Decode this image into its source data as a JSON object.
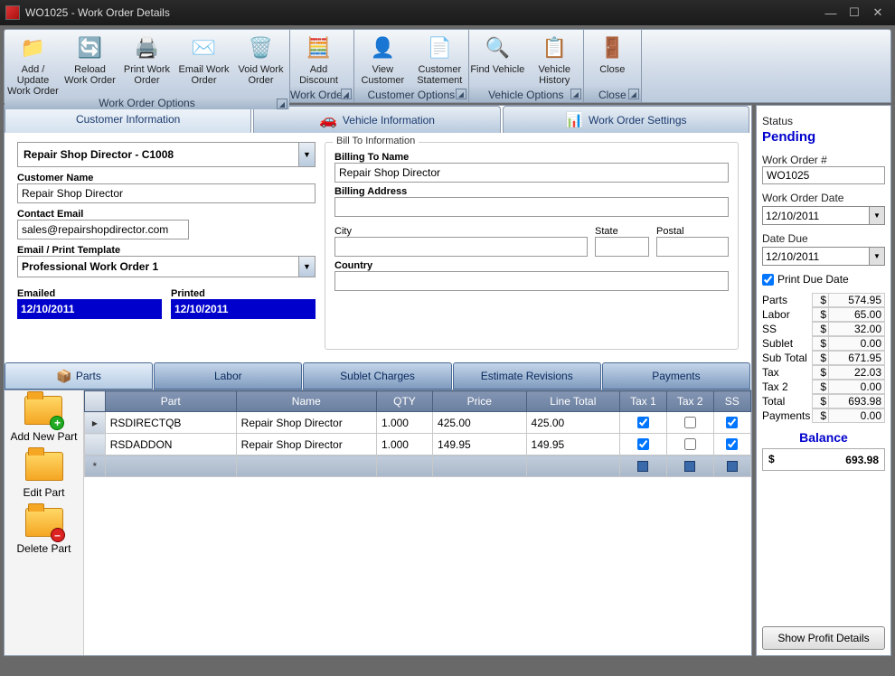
{
  "window": {
    "title": "WO1025 - Work Order Details"
  },
  "ribbon": {
    "groups": [
      {
        "label": "Work Order Options",
        "buttons": [
          {
            "icon": "📁",
            "label": "Add / Update\nWork Order"
          },
          {
            "icon": "🔄",
            "label": "Reload\nWork Order"
          },
          {
            "icon": "🖨️",
            "label": "Print Work\nOrder"
          },
          {
            "icon": "✉️",
            "label": "Email Work\nOrder"
          },
          {
            "icon": "🗑️",
            "label": "Void Work\nOrder"
          }
        ]
      },
      {
        "label": "Work Orde…",
        "buttons": [
          {
            "icon": "🧮",
            "label": "Add Discount"
          }
        ]
      },
      {
        "label": "Customer Options",
        "buttons": [
          {
            "icon": "👤",
            "label": "View Customer"
          },
          {
            "icon": "📄",
            "label": "Customer\nStatement"
          }
        ]
      },
      {
        "label": "Vehicle Options",
        "buttons": [
          {
            "icon": "🔍",
            "label": "Find Vehicle"
          },
          {
            "icon": "📋",
            "label": "Vehicle\nHistory"
          }
        ]
      },
      {
        "label": "Close",
        "buttons": [
          {
            "icon": "🚪",
            "label": "Close"
          }
        ]
      }
    ]
  },
  "tabs": [
    {
      "label": "Customer Information",
      "active": true
    },
    {
      "label": "Vehicle Information",
      "icon": "🚗"
    },
    {
      "label": "Work Order Settings",
      "icon": "📊"
    }
  ],
  "customer": {
    "combo": "Repair Shop Director - C1008",
    "name_label": "Customer Name",
    "name": "Repair Shop Director",
    "email_label": "Contact Email",
    "email": "sales@repairshopdirector.com",
    "template_label": "Email / Print Template",
    "template": "Professional Work Order 1",
    "emailed_label": "Emailed",
    "emailed": "12/10/2011",
    "printed_label": "Printed",
    "printed": "12/10/2011"
  },
  "billto": {
    "legend": "Bill To Information",
    "name_label": "Billing To Name",
    "name": "Repair Shop Director",
    "address_label": "Billing Address",
    "address": "",
    "city_label": "City",
    "city": "",
    "state_label": "State",
    "state": "",
    "postal_label": "Postal",
    "postal": "",
    "country_label": "Country",
    "country": ""
  },
  "subtabs": [
    {
      "label": "Parts",
      "active": true
    },
    {
      "label": "Labor"
    },
    {
      "label": "Sublet Charges"
    },
    {
      "label": "Estimate Revisions"
    },
    {
      "label": "Payments"
    }
  ],
  "grid_side": {
    "add": "Add New Part",
    "edit": "Edit Part",
    "del": "Delete Part"
  },
  "grid": {
    "headers": [
      "Part",
      "Name",
      "QTY",
      "Price",
      "Line Total",
      "Tax 1",
      "Tax 2",
      "SS"
    ],
    "rows": [
      {
        "part": "RSDIRECTQB",
        "name": "Repair Shop Director",
        "qty": "1.000",
        "price": "425.00",
        "total": "425.00",
        "t1": true,
        "t2": false,
        "ss": true,
        "marker": "▸"
      },
      {
        "part": "RSDADDON",
        "name": "Repair Shop Director",
        "qty": "1.000",
        "price": "149.95",
        "total": "149.95",
        "t1": true,
        "t2": false,
        "ss": true,
        "marker": ""
      }
    ],
    "newrow_marker": "*"
  },
  "side": {
    "status_label": "Status",
    "status": "Pending",
    "wonum_label": "Work Order #",
    "wonum": "WO1025",
    "wodate_label": "Work Order Date",
    "wodate": "12/10/2011",
    "due_label": "Date Due",
    "due": "12/10/2011",
    "print_due_label": "Print Due Date",
    "totals": [
      {
        "l": "Parts",
        "v": "574.95"
      },
      {
        "l": "Labor",
        "v": "65.00"
      },
      {
        "l": "SS",
        "v": "32.00"
      },
      {
        "l": "Sublet",
        "v": "0.00"
      },
      {
        "l": "Sub Total",
        "v": "671.95"
      },
      {
        "l": "Tax",
        "v": "22.03"
      },
      {
        "l": "Tax 2",
        "v": "0.00"
      },
      {
        "l": "Total",
        "v": "693.98"
      },
      {
        "l": "Payments",
        "v": "0.00"
      }
    ],
    "balance_label": "Balance",
    "balance": "693.98",
    "profit_btn": "Show Profit Details"
  }
}
